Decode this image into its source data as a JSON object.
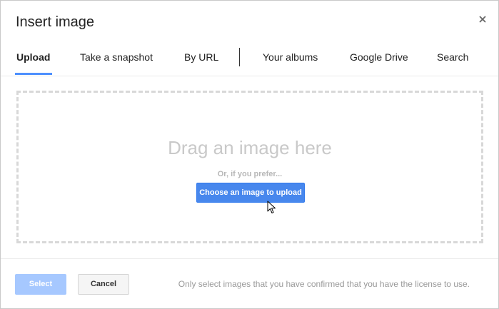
{
  "dialog": {
    "title": "Insert image",
    "close_icon": "close-icon"
  },
  "tabs": [
    {
      "label": "Upload",
      "active": true
    },
    {
      "label": "Take a snapshot",
      "active": false
    },
    {
      "label": "By URL",
      "active": false
    },
    {
      "label": "Your albums",
      "active": false
    },
    {
      "label": "Google Drive",
      "active": false
    },
    {
      "label": "Search",
      "active": false
    }
  ],
  "dropzone": {
    "title": "Drag an image here",
    "subtitle": "Or, if you prefer...",
    "upload_button": "Choose an image to upload"
  },
  "footer": {
    "select_button": "Select",
    "cancel_button": "Cancel",
    "license_text": "Only select images that you have confirmed that you have the license to use."
  },
  "colors": {
    "accent": "#4787ed",
    "tab_underline": "#4d90fe",
    "disabled_select": "#a6c8ff"
  }
}
